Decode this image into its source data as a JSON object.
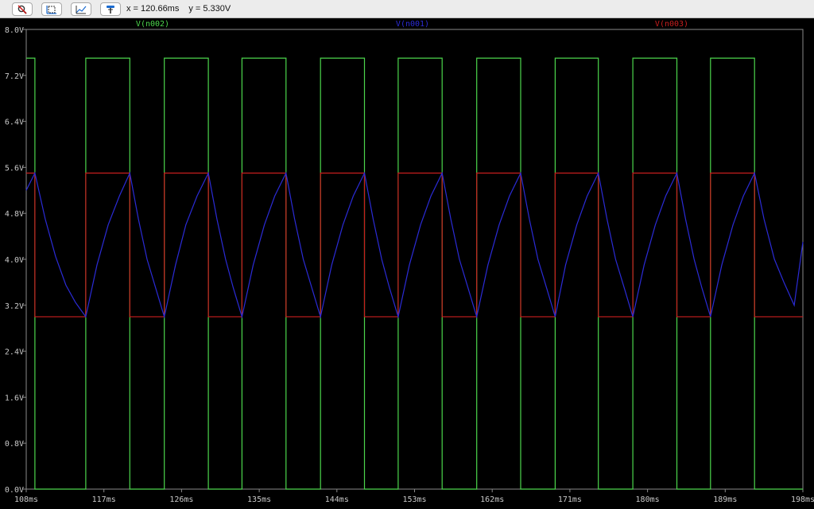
{
  "toolbar": {
    "buttons": [
      {
        "name": "autorange-button",
        "icon": "magnifier-cross-icon"
      },
      {
        "name": "zoom-box-button",
        "icon": "zoom-box-icon"
      },
      {
        "name": "zoom-to-fit-button",
        "icon": "zoom-fit-icon"
      },
      {
        "name": "probe-button",
        "icon": "probe-icon"
      }
    ],
    "readout_x": "x = 120.66ms",
    "readout_y": "y = 5.330V"
  },
  "colors": {
    "background": "#000000",
    "grid": "#8a8a8a",
    "tick_label": "#c8c8c8",
    "n002": "#4cd64c",
    "n001": "#2b2bd6",
    "n003": "#c81e1e"
  },
  "chart_data": {
    "type": "line",
    "xlim": [
      108,
      198
    ],
    "ylim": [
      0,
      8
    ],
    "x_unit": "ms",
    "y_unit": "V",
    "x_ticks": [
      "108ms",
      "117ms",
      "126ms",
      "135ms",
      "144ms",
      "153ms",
      "162ms",
      "171ms",
      "180ms",
      "189ms",
      "198ms"
    ],
    "y_ticks": [
      "0.0V",
      "0.8V",
      "1.6V",
      "2.4V",
      "3.2V",
      "4.0V",
      "4.8V",
      "5.6V",
      "6.4V",
      "7.2V",
      "8.0V"
    ],
    "grid": false,
    "series": [
      {
        "name": "V(n002)",
        "color": "#4cd64c",
        "x": [
          108,
          109,
          109,
          114.9,
          114.9,
          120,
          120,
          124,
          124,
          129.1,
          129.1,
          133.0,
          133.0,
          138.1,
          138.1,
          142.1,
          142.1,
          147.2,
          147.2,
          151.1,
          151.1,
          156.2,
          156.2,
          160.2,
          160.2,
          165.3,
          165.3,
          169.3,
          169.3,
          174.3,
          174.3,
          178.3,
          178.3,
          183.4,
          183.4,
          187.3,
          187.3,
          192.4,
          192.4,
          198
        ],
        "y": [
          7.5,
          7.5,
          0,
          0,
          7.5,
          7.5,
          0,
          0,
          7.5,
          7.5,
          0,
          0,
          7.5,
          7.5,
          0,
          0,
          7.5,
          7.5,
          0,
          0,
          7.5,
          7.5,
          0,
          0,
          7.5,
          7.5,
          0,
          0,
          7.5,
          7.5,
          0,
          0,
          7.5,
          7.5,
          0,
          0,
          7.5,
          7.5,
          0,
          0
        ]
      },
      {
        "name": "V(n001)",
        "color": "#2b2bd6",
        "x": [
          108,
          109,
          110.2,
          111.4,
          112.6,
          113.7,
          114.9,
          116.2,
          117.5,
          118.8,
          120,
          121.0,
          122.0,
          123.0,
          124,
          125.3,
          126.5,
          127.8,
          129.1,
          130.1,
          131.1,
          132.0,
          133.0,
          134.3,
          135.6,
          136.8,
          138.1,
          139.1,
          140.1,
          141.1,
          142.1,
          143.4,
          144.7,
          145.9,
          147.2,
          148.2,
          149.2,
          150.1,
          151.1,
          152.4,
          153.7,
          154.9,
          156.2,
          157.2,
          158.2,
          159.2,
          160.2,
          161.5,
          162.8,
          164.0,
          165.3,
          166.3,
          167.3,
          168.3,
          169.3,
          170.5,
          171.8,
          173.0,
          174.3,
          175.3,
          176.3,
          177.3,
          178.3,
          179.6,
          180.9,
          182.1,
          183.4,
          184.4,
          185.4,
          186.3,
          187.3,
          188.6,
          189.9,
          191.1,
          192.4,
          193.5,
          194.7,
          195.8,
          197,
          198
        ],
        "y": [
          5.2,
          5.5,
          4.7,
          4.05,
          3.55,
          3.25,
          3.0,
          3.9,
          4.6,
          5.1,
          5.5,
          4.7,
          4.0,
          3.5,
          3.0,
          3.9,
          4.6,
          5.1,
          5.5,
          4.7,
          4.0,
          3.5,
          3.0,
          3.9,
          4.6,
          5.1,
          5.5,
          4.7,
          4.0,
          3.5,
          3.0,
          3.9,
          4.6,
          5.1,
          5.5,
          4.7,
          4.0,
          3.5,
          3.0,
          3.9,
          4.6,
          5.1,
          5.5,
          4.7,
          4.0,
          3.5,
          3.0,
          3.9,
          4.6,
          5.1,
          5.5,
          4.7,
          4.0,
          3.5,
          3.0,
          3.9,
          4.6,
          5.1,
          5.5,
          4.7,
          4.0,
          3.5,
          3.0,
          3.9,
          4.6,
          5.1,
          5.5,
          4.7,
          4.0,
          3.5,
          3.0,
          3.9,
          4.6,
          5.1,
          5.5,
          4.7,
          4.0,
          3.6,
          3.2,
          4.3
        ]
      },
      {
        "name": "V(n003)",
        "color": "#c81e1e",
        "x": [
          108,
          109,
          109,
          114.9,
          114.9,
          120,
          120,
          124,
          124,
          129.1,
          129.1,
          133.0,
          133.0,
          138.1,
          138.1,
          142.1,
          142.1,
          147.2,
          147.2,
          151.1,
          151.1,
          156.2,
          156.2,
          160.2,
          160.2,
          165.3,
          165.3,
          169.3,
          169.3,
          174.3,
          174.3,
          178.3,
          178.3,
          183.4,
          183.4,
          187.3,
          187.3,
          192.4,
          192.4,
          198
        ],
        "y": [
          5.5,
          5.5,
          3.0,
          3.0,
          5.5,
          5.5,
          3.0,
          3.0,
          5.5,
          5.5,
          3.0,
          3.0,
          5.5,
          5.5,
          3.0,
          3.0,
          5.5,
          5.5,
          3.0,
          3.0,
          5.5,
          5.5,
          3.0,
          3.0,
          5.5,
          5.5,
          3.0,
          3.0,
          5.5,
          5.5,
          3.0,
          3.0,
          5.5,
          5.5,
          3.0,
          3.0,
          5.5,
          5.5,
          3.0,
          3.0
        ]
      }
    ]
  }
}
